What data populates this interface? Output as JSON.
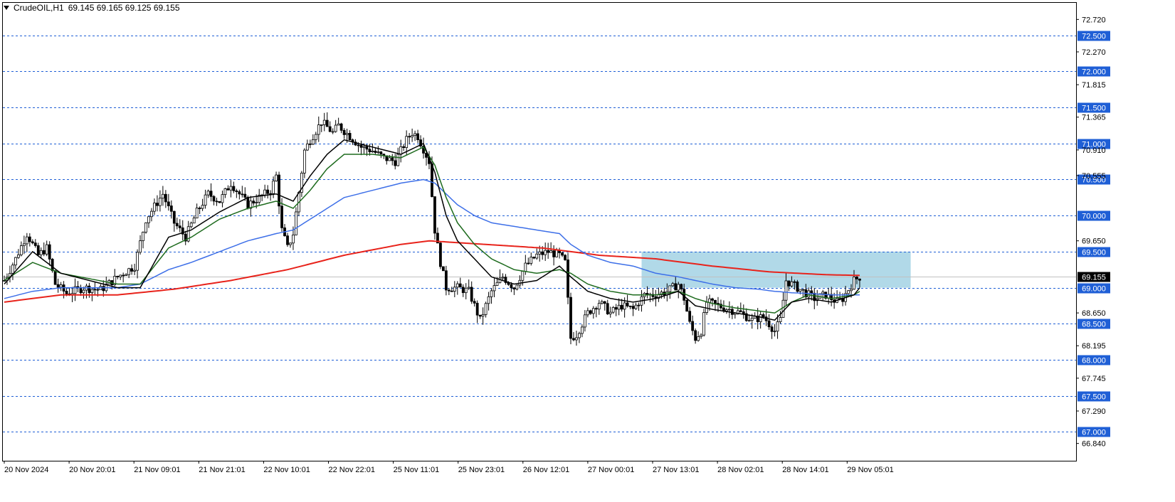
{
  "header": {
    "symbol": "CrudeOIL,H1",
    "ohlc": "69.145 69.165 69.125 69.155"
  },
  "colors": {
    "level_line": "#1f5fd6",
    "ma_fast": "#000000",
    "ma_mid": "#1e6b1e",
    "ma_slow": "#3d6fe8",
    "ma_long": "#e8231b",
    "zone": "#a9d5e5",
    "price_tag": "#000000"
  },
  "current_price": {
    "label": "69.155",
    "value": 69.155
  },
  "chart_data": {
    "type": "candlestick",
    "ylim": [
      66.6,
      72.95
    ],
    "y_ticks": [
      "72.720",
      "72.270",
      "71.815",
      "71.365",
      "70.910",
      "70.555",
      "69.650",
      "68.650",
      "68.195",
      "67.745",
      "67.290",
      "66.840"
    ],
    "level_lines": [
      "72.500",
      "72.000",
      "71.500",
      "71.000",
      "70.500",
      "70.000",
      "69.500",
      "69.000",
      "68.500",
      "68.000",
      "67.500",
      "67.000"
    ],
    "x_labels": [
      "20 Nov 2024",
      "20 Nov 20:01",
      "21 Nov 09:01",
      "21 Nov 21:01",
      "22 Nov 10:01",
      "22 Nov 22:01",
      "25 Nov 11:01",
      "25 Nov 23:01",
      "26 Nov 12:01",
      "27 Nov 00:01",
      "27 Nov 13:01",
      "28 Nov 02:01",
      "28 Nov 14:01",
      "29 Nov 05:01"
    ],
    "bar_count": 200,
    "close_path": [
      [
        0,
        69.1
      ],
      [
        4,
        69.4
      ],
      [
        8,
        69.75
      ],
      [
        12,
        69.45
      ],
      [
        15,
        69.55
      ],
      [
        18,
        69.05
      ],
      [
        22,
        68.92
      ],
      [
        28,
        69.0
      ],
      [
        34,
        68.97
      ],
      [
        40,
        69.15
      ],
      [
        46,
        69.3
      ],
      [
        50,
        69.95
      ],
      [
        56,
        70.3
      ],
      [
        60,
        69.9
      ],
      [
        64,
        69.7
      ],
      [
        68,
        70.05
      ],
      [
        72,
        70.3
      ],
      [
        76,
        70.2
      ],
      [
        80,
        70.45
      ],
      [
        86,
        70.15
      ],
      [
        90,
        70.25
      ],
      [
        94,
        70.35
      ],
      [
        96,
        70.55
      ],
      [
        98,
        69.8
      ],
      [
        100,
        69.55
      ],
      [
        102,
        69.75
      ],
      [
        106,
        70.9
      ],
      [
        108,
        71.05
      ],
      [
        112,
        71.3
      ],
      [
        116,
        71.15
      ],
      [
        118,
        71.25
      ],
      [
        122,
        71.1
      ],
      [
        126,
        70.95
      ],
      [
        130,
        70.9
      ],
      [
        134,
        70.8
      ],
      [
        138,
        70.75
      ],
      [
        142,
        71.05
      ],
      [
        144,
        71.15
      ],
      [
        146,
        71.1
      ],
      [
        150,
        70.75
      ],
      [
        152,
        69.8
      ],
      [
        154,
        69.35
      ],
      [
        156,
        69.0
      ],
      [
        160,
        69.0
      ],
      [
        164,
        68.95
      ],
      [
        168,
        68.55
      ],
      [
        172,
        68.95
      ],
      [
        176,
        69.15
      ],
      [
        180,
        69.0
      ],
      [
        184,
        69.3
      ],
      [
        188,
        69.45
      ],
      [
        192,
        69.5
      ],
      [
        196,
        69.45
      ],
      [
        198,
        69.35
      ],
      [
        200,
        68.3
      ],
      [
        202,
        68.35
      ],
      [
        204,
        68.5
      ],
      [
        206,
        68.65
      ],
      [
        210,
        68.8
      ],
      [
        214,
        68.65
      ],
      [
        218,
        68.75
      ],
      [
        222,
        68.7
      ],
      [
        226,
        68.9
      ],
      [
        230,
        68.9
      ],
      [
        234,
        68.95
      ],
      [
        238,
        69.05
      ],
      [
        240,
        68.85
      ],
      [
        242,
        68.5
      ],
      [
        244,
        68.3
      ],
      [
        246,
        68.4
      ],
      [
        248,
        68.8
      ],
      [
        252,
        68.75
      ],
      [
        256,
        68.7
      ],
      [
        260,
        68.65
      ],
      [
        264,
        68.55
      ],
      [
        268,
        68.6
      ],
      [
        272,
        68.4
      ],
      [
        274,
        68.55
      ],
      [
        276,
        69.1
      ],
      [
        278,
        69.05
      ],
      [
        282,
        68.95
      ],
      [
        286,
        68.85
      ],
      [
        290,
        68.9
      ],
      [
        294,
        68.8
      ],
      [
        296,
        68.85
      ],
      [
        300,
        69.1
      ],
      [
        302,
        69.15
      ]
    ],
    "ma_fast": [
      [
        0,
        69.05
      ],
      [
        10,
        69.5
      ],
      [
        20,
        69.2
      ],
      [
        40,
        69.0
      ],
      [
        48,
        69.0
      ],
      [
        58,
        69.7
      ],
      [
        66,
        69.8
      ],
      [
        76,
        70.05
      ],
      [
        86,
        70.25
      ],
      [
        96,
        70.3
      ],
      [
        102,
        70.2
      ],
      [
        108,
        70.55
      ],
      [
        114,
        70.85
      ],
      [
        120,
        71.05
      ],
      [
        130,
        70.95
      ],
      [
        140,
        70.85
      ],
      [
        148,
        71.0
      ],
      [
        152,
        70.6
      ],
      [
        156,
        70.0
      ],
      [
        160,
        69.65
      ],
      [
        166,
        69.4
      ],
      [
        172,
        69.15
      ],
      [
        180,
        69.05
      ],
      [
        188,
        69.1
      ],
      [
        196,
        69.3
      ],
      [
        200,
        69.15
      ],
      [
        206,
        68.95
      ],
      [
        214,
        68.85
      ],
      [
        222,
        68.8
      ],
      [
        230,
        68.85
      ],
      [
        238,
        68.95
      ],
      [
        244,
        68.75
      ],
      [
        250,
        68.7
      ],
      [
        258,
        68.65
      ],
      [
        266,
        68.6
      ],
      [
        272,
        68.55
      ],
      [
        278,
        68.8
      ],
      [
        284,
        68.85
      ],
      [
        292,
        68.8
      ],
      [
        300,
        68.9
      ],
      [
        302,
        69.0
      ]
    ],
    "ma_mid": [
      [
        0,
        69.1
      ],
      [
        10,
        69.35
      ],
      [
        20,
        69.2
      ],
      [
        40,
        69.05
      ],
      [
        48,
        69.05
      ],
      [
        58,
        69.55
      ],
      [
        66,
        69.7
      ],
      [
        76,
        69.95
      ],
      [
        86,
        70.1
      ],
      [
        96,
        70.2
      ],
      [
        102,
        70.1
      ],
      [
        108,
        70.35
      ],
      [
        114,
        70.65
      ],
      [
        120,
        70.85
      ],
      [
        130,
        70.85
      ],
      [
        140,
        70.8
      ],
      [
        148,
        70.95
      ],
      [
        152,
        70.7
      ],
      [
        156,
        70.25
      ],
      [
        160,
        69.9
      ],
      [
        166,
        69.6
      ],
      [
        172,
        69.4
      ],
      [
        180,
        69.25
      ],
      [
        188,
        69.2
      ],
      [
        196,
        69.25
      ],
      [
        200,
        69.2
      ],
      [
        206,
        69.05
      ],
      [
        214,
        68.95
      ],
      [
        222,
        68.9
      ],
      [
        230,
        68.9
      ],
      [
        238,
        68.95
      ],
      [
        244,
        68.85
      ],
      [
        250,
        68.78
      ],
      [
        258,
        68.72
      ],
      [
        266,
        68.68
      ],
      [
        272,
        68.65
      ],
      [
        278,
        68.8
      ],
      [
        284,
        68.9
      ],
      [
        292,
        68.85
      ],
      [
        300,
        68.9
      ],
      [
        302,
        68.95
      ]
    ],
    "ma_slow": [
      [
        0,
        68.85
      ],
      [
        10,
        68.95
      ],
      [
        20,
        69.0
      ],
      [
        40,
        69.0
      ],
      [
        48,
        69.05
      ],
      [
        58,
        69.25
      ],
      [
        66,
        69.35
      ],
      [
        76,
        69.5
      ],
      [
        86,
        69.65
      ],
      [
        96,
        69.75
      ],
      [
        102,
        69.8
      ],
      [
        108,
        69.95
      ],
      [
        114,
        70.1
      ],
      [
        120,
        70.25
      ],
      [
        130,
        70.35
      ],
      [
        140,
        70.45
      ],
      [
        148,
        70.5
      ],
      [
        152,
        70.45
      ],
      [
        156,
        70.3
      ],
      [
        160,
        70.15
      ],
      [
        166,
        70.0
      ],
      [
        172,
        69.9
      ],
      [
        180,
        69.85
      ],
      [
        188,
        69.8
      ],
      [
        196,
        69.75
      ],
      [
        200,
        69.6
      ],
      [
        206,
        69.45
      ],
      [
        214,
        69.35
      ],
      [
        222,
        69.3
      ],
      [
        230,
        69.2
      ],
      [
        238,
        69.15
      ],
      [
        244,
        69.1
      ],
      [
        250,
        69.05
      ],
      [
        258,
        69.0
      ],
      [
        266,
        68.98
      ],
      [
        272,
        68.95
      ],
      [
        278,
        68.93
      ],
      [
        284,
        68.92
      ],
      [
        292,
        68.9
      ],
      [
        300,
        68.9
      ],
      [
        302,
        68.9
      ]
    ],
    "ma_long": [
      [
        0,
        68.8
      ],
      [
        20,
        68.9
      ],
      [
        40,
        68.9
      ],
      [
        60,
        68.98
      ],
      [
        80,
        69.1
      ],
      [
        100,
        69.25
      ],
      [
        120,
        69.45
      ],
      [
        140,
        69.6
      ],
      [
        150,
        69.65
      ],
      [
        170,
        69.6
      ],
      [
        190,
        69.55
      ],
      [
        210,
        69.45
      ],
      [
        230,
        69.4
      ],
      [
        250,
        69.3
      ],
      [
        270,
        69.22
      ],
      [
        290,
        69.18
      ],
      [
        302,
        69.17
      ]
    ],
    "zone": {
      "x_start": 225,
      "x_end": 320,
      "y_low": 69.0,
      "y_high": 69.5
    }
  }
}
